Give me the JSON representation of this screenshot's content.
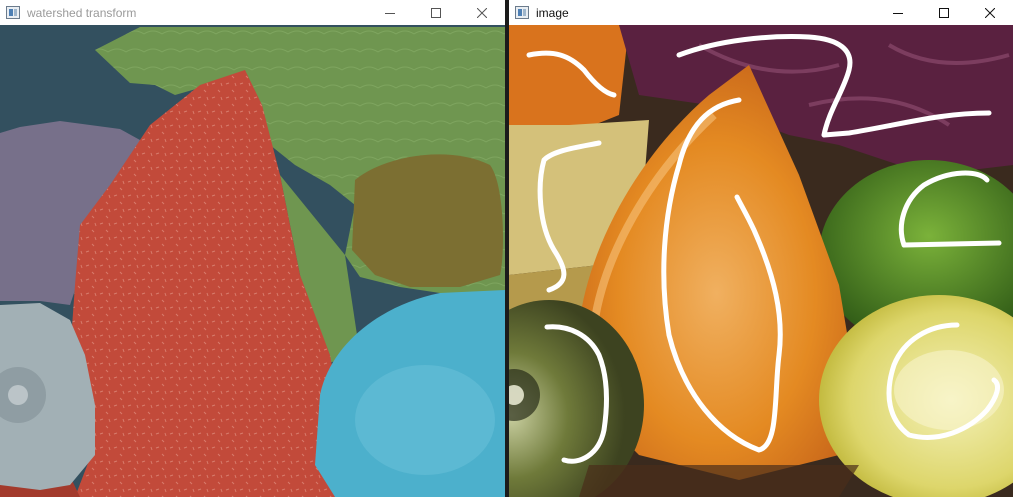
{
  "windows": {
    "left": {
      "title": "watershed transform",
      "icon": "opencv-window-icon",
      "controls": [
        "minimize",
        "maximize",
        "close"
      ]
    },
    "right": {
      "title": "image",
      "icon": "opencv-window-icon",
      "controls": [
        "minimize",
        "maximize",
        "close"
      ]
    }
  },
  "colors": {
    "segment_dark_blue": "#33505f",
    "segment_green": "#6f9650",
    "segment_red": "#c24a3a",
    "segment_purple": "#77708a",
    "segment_olive": "#7c6f32",
    "segment_cyan": "#4cb0cc",
    "segment_gray": "#a2b0b5",
    "marker_stroke": "#ffffff",
    "orange": "#e48a22",
    "lime": "#5c8a2a",
    "lemon": "#d9d54a",
    "cabbage": "#5a2140"
  }
}
